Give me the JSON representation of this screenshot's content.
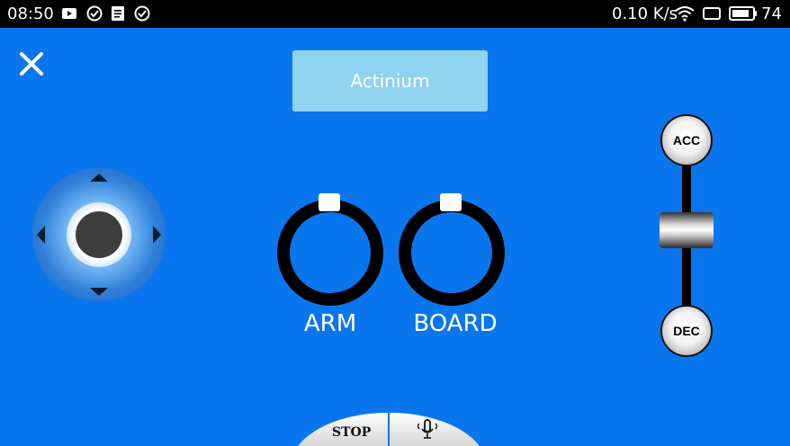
{
  "status_bar": {
    "time": "08:50",
    "net_speed": "0.10 K/s",
    "battery": "74",
    "icons": [
      "youtube-icon",
      "check-circle-icon",
      "document-icon",
      "check-circle-icon",
      "wifi-icon",
      "screen-icon",
      "battery-icon"
    ]
  },
  "header": {
    "close_icon": "close-icon",
    "device_name": "Actinium"
  },
  "controls": {
    "joystick": "joystick",
    "arm_label": "ARM",
    "board_label": "BOARD",
    "acc_label": "ACC",
    "dec_label": "DEC"
  },
  "bottom_bar": {
    "stop_label": "STOP",
    "voice_icon": "microphone-icon"
  },
  "colors": {
    "background": "#0a76ee",
    "name_box": "#8fd3f0"
  }
}
